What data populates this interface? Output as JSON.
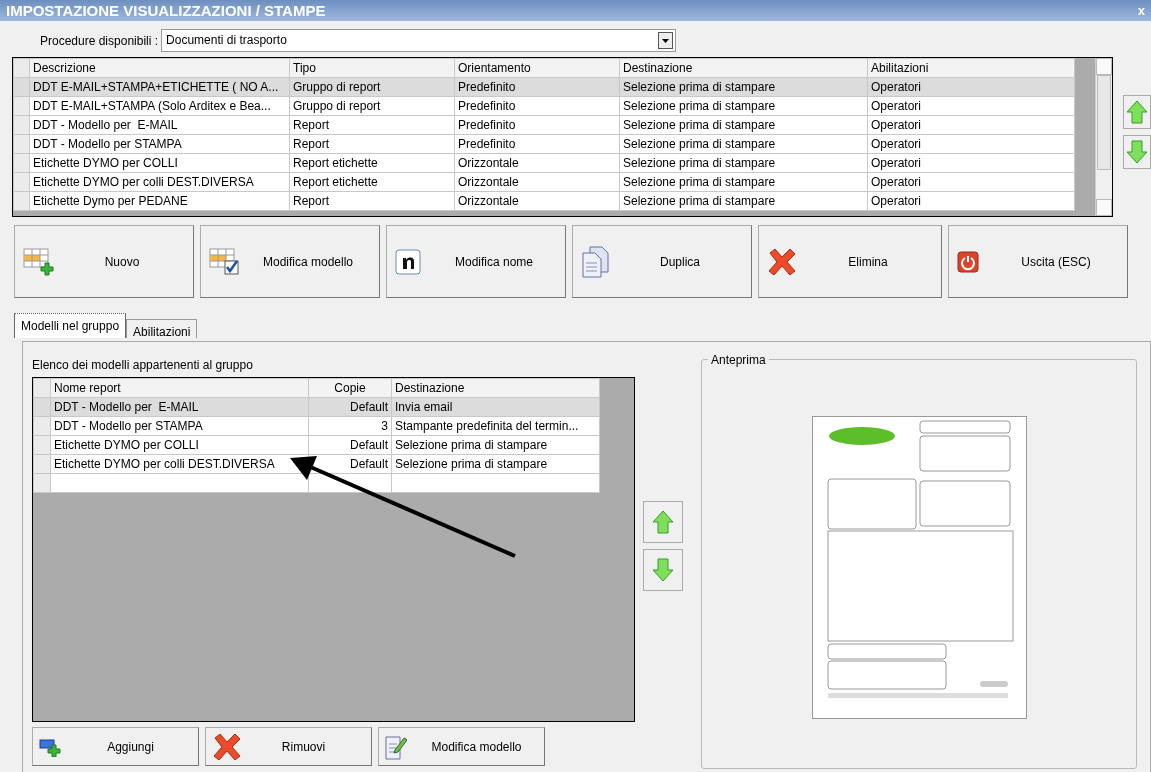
{
  "window": {
    "title": "IMPOSTAZIONE VISUALIZZAZIONI / STAMPE",
    "close": "x"
  },
  "procedure": {
    "label": "Procedure disponibili :",
    "value": "Documenti di trasporto"
  },
  "reports_table": {
    "columns": [
      "Descrizione",
      "Tipo",
      "Orientamento",
      "Destinazione",
      "Abilitazioni"
    ],
    "rows": [
      {
        "cells": [
          "DDT E-MAIL+STAMPA+ETICHETTE ( NO A...",
          "Gruppo di report",
          "Predefinito",
          "Selezione prima di stampare",
          "Operatori"
        ],
        "selected": true
      },
      {
        "cells": [
          "DDT E-MAIL+STAMPA (Solo Arditex e Bea...",
          "Gruppo di report",
          "Predefinito",
          "Selezione prima di stampare",
          "Operatori"
        ],
        "selected": false
      },
      {
        "cells": [
          "DDT - Modello per  E-MAIL",
          "Report",
          "Predefinito",
          "Selezione prima di stampare",
          "Operatori"
        ],
        "selected": false
      },
      {
        "cells": [
          "DDT - Modello per STAMPA",
          "Report",
          "Predefinito",
          "Selezione prima di stampare",
          "Operatori"
        ],
        "selected": false
      },
      {
        "cells": [
          "Etichette DYMO per COLLI",
          "Report etichette",
          "Orizzontale",
          "Selezione prima di stampare",
          "Operatori"
        ],
        "selected": false
      },
      {
        "cells": [
          "Etichette DYMO per colli DEST.DIVERSA",
          "Report etichette",
          "Orizzontale",
          "Selezione prima di stampare",
          "Operatori"
        ],
        "selected": false
      },
      {
        "cells": [
          "Etichette Dymo per PEDANE",
          "Report",
          "Orizzontale",
          "Selezione prima di stampare",
          "Operatori"
        ],
        "selected": false
      }
    ]
  },
  "toolbar": [
    {
      "label": "Nuovo",
      "kind": "new"
    },
    {
      "label": "Modifica modello",
      "kind": "edit-grid"
    },
    {
      "label": "Modifica nome",
      "kind": "rename"
    },
    {
      "label": "Duplica",
      "kind": "copy"
    },
    {
      "label": "Elimina",
      "kind": "delete"
    },
    {
      "label": "Uscita (ESC)",
      "kind": "exit"
    }
  ],
  "tabs": [
    {
      "label": "Modelli nel gruppo",
      "selected": true
    },
    {
      "label": "Abilitazioni",
      "selected": false
    }
  ],
  "group_panel": {
    "caption": "Elenco dei modelli appartenenti al gruppo",
    "columns": [
      "Nome report",
      "Copie",
      "Destinazione"
    ],
    "rows": [
      {
        "cells": [
          "DDT - Modello per  E-MAIL",
          "Default",
          "Invia email"
        ],
        "selected": true
      },
      {
        "cells": [
          "DDT - Modello per STAMPA",
          "3",
          "Stampante predefinita del termin..."
        ],
        "selected": false
      },
      {
        "cells": [
          "Etichette DYMO per COLLI",
          "Default",
          "Selezione prima di stampare"
        ],
        "selected": false
      },
      {
        "cells": [
          "Etichette DYMO per colli DEST.DIVERSA",
          "Default",
          "Selezione prima di stampare"
        ],
        "selected": false
      }
    ]
  },
  "panel_buttons": [
    {
      "label": "Aggiungi",
      "kind": "add"
    },
    {
      "label": "Rimuovi",
      "kind": "delete"
    },
    {
      "label": "Modifica modello",
      "kind": "edit-doc"
    }
  ],
  "preview": {
    "title": "Anteprima"
  }
}
